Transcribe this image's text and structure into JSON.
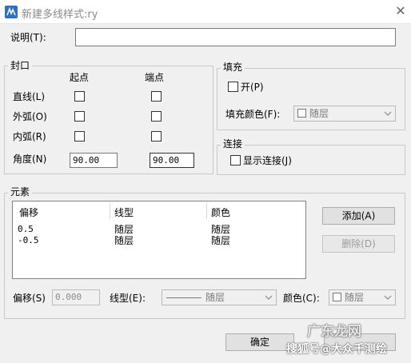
{
  "window": {
    "title": "新建多线样式:ry",
    "close_glyph": "✕"
  },
  "description": {
    "label": "说明(T):",
    "value": ""
  },
  "caps": {
    "group_title": "封口",
    "col_start": "起点",
    "col_end": "端点",
    "rows": [
      {
        "label": "直线(L)",
        "start": false,
        "end": false
      },
      {
        "label": "外弧(O)",
        "start": false,
        "end": false
      },
      {
        "label": "内弧(R)",
        "start": false,
        "end": false
      }
    ],
    "angle_label": "角度(N)",
    "angle_start": "90.00",
    "angle_end": "90.00"
  },
  "fill": {
    "group_title": "填充",
    "on_label": "开(P)",
    "on_checked": false,
    "color_label": "填充颜色(F):",
    "color_value": "随层"
  },
  "connect": {
    "group_title": "连接",
    "show_label": "显示连接(J)",
    "show_checked": false
  },
  "elements": {
    "group_title": "元素",
    "columns": [
      "偏移",
      "线型",
      "颜色"
    ],
    "rows": [
      {
        "offset": "0.5",
        "linetype": "随层",
        "color": "随层"
      },
      {
        "offset": "-0.5",
        "linetype": "随层",
        "color": "随层"
      }
    ],
    "add_button": "添加(A)",
    "delete_button": "删除(D)",
    "offset_label": "偏移(S)",
    "offset_value": "0.000",
    "linetype_label": "线型(E):",
    "linetype_value": "随层",
    "color_label": "颜色(C):",
    "color_value": "随层"
  },
  "footer": {
    "ok_button": "确定"
  },
  "watermark": {
    "text": "搜狐号@大众千测绘",
    "logo_text": "广东龙网"
  }
}
